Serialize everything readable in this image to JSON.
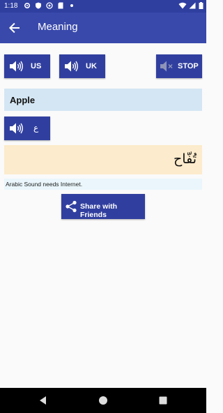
{
  "status_bar": {
    "time": "1:18",
    "left_icons": [
      "gear-icon",
      "shield-icon",
      "sync-icon",
      "sd-card-icon",
      "dot-icon"
    ],
    "right_icons": [
      "wifi-icon",
      "signal-icon",
      "battery-icon"
    ]
  },
  "app_bar": {
    "title": "Meaning",
    "back_icon": "arrow-back-icon"
  },
  "buttons": {
    "us_label": "US",
    "uk_label": "UK",
    "stop_label": "STOP",
    "arabic_label": "ع"
  },
  "word": "Apple",
  "meaning": "تُفّاح",
  "note": "Arabic Sound needs Internet.",
  "share_label": "Share with Friends",
  "colors": {
    "primary": "#3949ab",
    "primary_dark": "#303f9f",
    "word_bg": "#d4e6f3",
    "meaning_bg": "#fcebcc",
    "note_bg": "#eaf6fb"
  }
}
